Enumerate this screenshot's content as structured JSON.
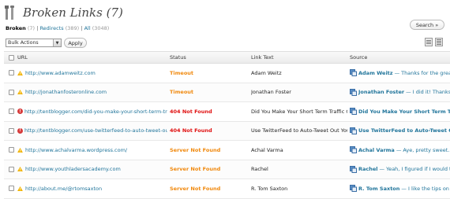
{
  "page": {
    "title": "Broken Links (7)"
  },
  "filters": [
    {
      "label": "Broken",
      "count": "(7)",
      "current": true
    },
    {
      "label": "Redirects",
      "count": "(389)",
      "current": false
    },
    {
      "label": "All",
      "count": "(3048)",
      "current": false
    }
  ],
  "toolbar": {
    "search_label": "Search »",
    "bulk_actions": "Bulk Actions",
    "apply_label": "Apply"
  },
  "table": {
    "columns": [
      "URL",
      "Status",
      "Link Text",
      "Source"
    ],
    "rows": [
      {
        "icon": "warning-icon",
        "url": "http://www.adamweitz.com",
        "status": "Timeout",
        "status_color": "#f0880c",
        "link_text": "Adam Weitz",
        "source_author": "Adam Weitz",
        "source_text": "— Thanks for the great g",
        "source_bold": false
      },
      {
        "icon": "warning-icon",
        "url": "http://jonathanfosteronline.com",
        "status": "Timeout",
        "status_color": "#f0880c",
        "link_text": "Jonathan Foster",
        "source_author": "Jonathan Foster",
        "source_text": "— I did it! Thanks so",
        "source_bold": false
      },
      {
        "icon": "error-icon",
        "url": "http://tentblogger.com/did-you-make-your-short-term-tra",
        "status": "404 Not Found",
        "status_color": "#e01010",
        "link_text": "Did You Make Your Short Term Traffic Go",
        "source_author": "Did You Make Your Short Term Traffic Go",
        "source_text": "",
        "source_bold": true
      },
      {
        "icon": "error-icon",
        "url": "http://tentblogger.com/use-twitterfeed-to-auto-tweet-out-",
        "status": "404 Not Found",
        "status_color": "#e01010",
        "link_text": "Use TwitterFeed to Auto-Tweet Out Your",
        "source_author": "Use TwitterFeed to Auto-Tweet Out",
        "source_text": "",
        "source_bold": true
      },
      {
        "icon": "warning-icon",
        "url": "http://www.achalvarma.wordpress.com/",
        "status": "Server Not Found",
        "status_color": "#f0880c",
        "link_text": "Achal Varma",
        "source_author": "Achal Varma",
        "source_text": "— Aye, pretty sweet. :D",
        "source_bold": false
      },
      {
        "icon": "warning-icon",
        "url": "http://www.youthladersacademy.com",
        "status": "Server Not Found",
        "status_color": "#f0880c",
        "link_text": "Rachel",
        "source_author": "Rachel",
        "source_text": "— Yeah, I figured if I would ta",
        "source_bold": false
      },
      {
        "icon": "warning-icon",
        "url": "http://about.me/@rtomsaxton",
        "status": "Server Not Found",
        "status_color": "#f0880c",
        "link_text": "R. Tom Saxton",
        "source_author": "R. Tom Saxton",
        "source_text": "— I like the tips on h",
        "source_bold": false
      }
    ]
  }
}
